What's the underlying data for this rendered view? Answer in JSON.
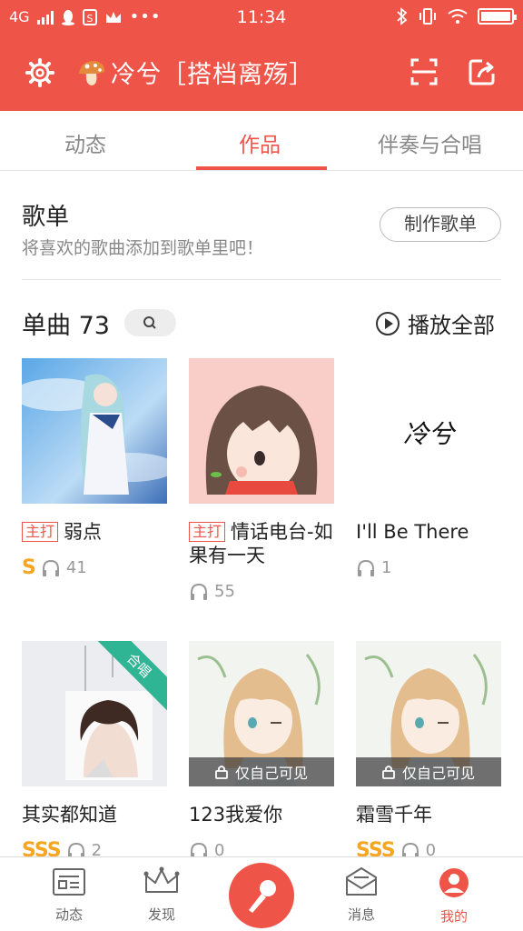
{
  "status_bar": {
    "network": "4G",
    "time": "11:34"
  },
  "header": {
    "title": "冷兮［搭档离殇］"
  },
  "tabs": [
    {
      "label": "动态"
    },
    {
      "label": "作品"
    },
    {
      "label": "伴奏与合唱"
    }
  ],
  "playlist": {
    "title": "歌单",
    "subtitle": "将喜欢的歌曲添加到歌单里吧！",
    "create_button": "制作歌单"
  },
  "singles": {
    "label": "单曲",
    "count": "73",
    "play_all": "播放全部"
  },
  "songs": [
    {
      "name": "弱点",
      "tag": "主打",
      "grade": "S",
      "plays": "41"
    },
    {
      "name": "情话电台-如果有一天",
      "tag": "主打",
      "grade": "",
      "plays": "55"
    },
    {
      "name": "I'll Be There",
      "tag": "",
      "grade": "",
      "plays": "1",
      "cover_text": "冷兮"
    },
    {
      "name": "其实都知道",
      "tag": "",
      "grade": "SSS",
      "plays": "2",
      "ribbon": "合唱"
    },
    {
      "name": "123我爱你",
      "tag": "",
      "grade": "",
      "plays": "0",
      "private": "仅自己可见"
    },
    {
      "name": "霜雪千年",
      "tag": "",
      "grade": "SSS",
      "plays": "0",
      "private": "仅自己可见"
    }
  ],
  "bottom_nav": [
    {
      "label": "动态",
      "icon": "feed-icon"
    },
    {
      "label": "发现",
      "icon": "crown-icon"
    },
    {
      "label": "",
      "icon": "microphone-icon"
    },
    {
      "label": "消息",
      "icon": "mail-icon"
    },
    {
      "label": "我的",
      "icon": "profile-icon"
    }
  ],
  "colors": {
    "accent": "#ef5448",
    "grade": "#f5a623",
    "ribbon": "#2fb494"
  }
}
